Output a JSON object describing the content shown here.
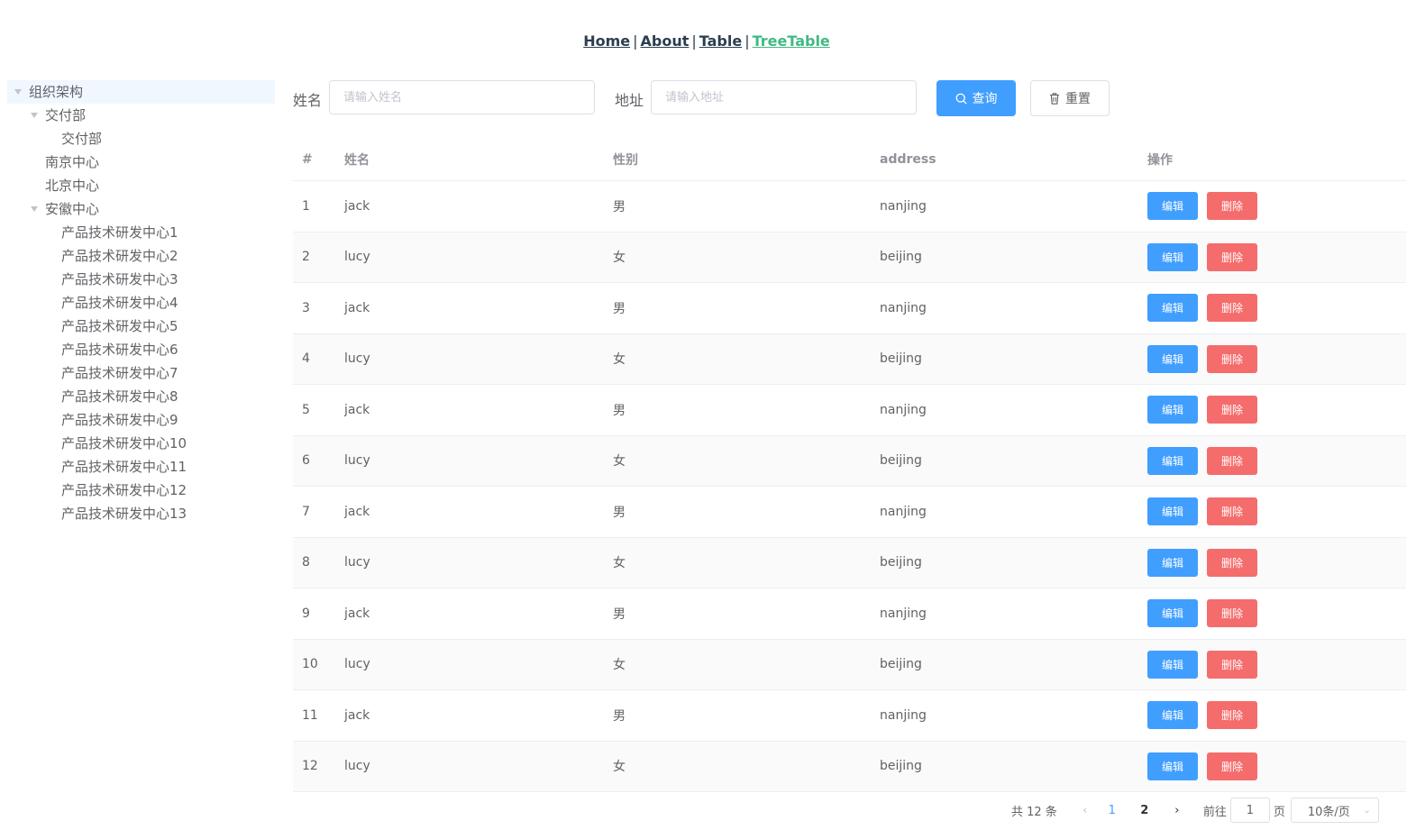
{
  "nav": {
    "links": [
      "Home",
      "About",
      "Table",
      "TreeTable"
    ],
    "separator": "|",
    "active": "TreeTable"
  },
  "tree": {
    "root": "组织架构",
    "nodes": [
      {
        "label": "交付部",
        "expanded": true,
        "level": 1
      },
      {
        "label": "交付部",
        "level": 2
      },
      {
        "label": "南京中心",
        "level": 1
      },
      {
        "label": "北京中心",
        "level": 1
      },
      {
        "label": "安徽中心",
        "expanded": true,
        "level": 1
      },
      {
        "label": "产品技术研发中心1",
        "level": 2
      },
      {
        "label": "产品技术研发中心2",
        "level": 2
      },
      {
        "label": "产品技术研发中心3",
        "level": 2
      },
      {
        "label": "产品技术研发中心4",
        "level": 2
      },
      {
        "label": "产品技术研发中心5",
        "level": 2
      },
      {
        "label": "产品技术研发中心6",
        "level": 2
      },
      {
        "label": "产品技术研发中心7",
        "level": 2
      },
      {
        "label": "产品技术研发中心8",
        "level": 2
      },
      {
        "label": "产品技术研发中心9",
        "level": 2
      },
      {
        "label": "产品技术研发中心10",
        "level": 2
      },
      {
        "label": "产品技术研发中心11",
        "level": 2
      },
      {
        "label": "产品技术研发中心12",
        "level": 2
      },
      {
        "label": "产品技术研发中心13",
        "level": 2
      }
    ]
  },
  "search": {
    "name_label": "姓名",
    "name_placeholder": "请输入姓名",
    "name_value": "",
    "address_label": "地址",
    "address_placeholder": "请输入地址",
    "address_value": "",
    "query_label": "查询",
    "reset_label": "重置"
  },
  "table": {
    "headers": [
      "#",
      "姓名",
      "性别",
      "address",
      "操作"
    ],
    "edit_label": "编辑",
    "delete_label": "删除",
    "rows": [
      {
        "id": "1",
        "name": "jack",
        "gender": "男",
        "address": "nanjing"
      },
      {
        "id": "2",
        "name": "lucy",
        "gender": "女",
        "address": "beijing"
      },
      {
        "id": "3",
        "name": "jack",
        "gender": "男",
        "address": "nanjing"
      },
      {
        "id": "4",
        "name": "lucy",
        "gender": "女",
        "address": "beijing"
      },
      {
        "id": "5",
        "name": "jack",
        "gender": "男",
        "address": "nanjing"
      },
      {
        "id": "6",
        "name": "lucy",
        "gender": "女",
        "address": "beijing"
      },
      {
        "id": "7",
        "name": "jack",
        "gender": "男",
        "address": "nanjing"
      },
      {
        "id": "8",
        "name": "lucy",
        "gender": "女",
        "address": "beijing"
      },
      {
        "id": "9",
        "name": "jack",
        "gender": "男",
        "address": "nanjing"
      },
      {
        "id": "10",
        "name": "lucy",
        "gender": "女",
        "address": "beijing"
      },
      {
        "id": "11",
        "name": "jack",
        "gender": "男",
        "address": "nanjing"
      },
      {
        "id": "12",
        "name": "lucy",
        "gender": "女",
        "address": "beijing"
      }
    ]
  },
  "pagination": {
    "total_text": "共 12 条",
    "pages": [
      "1",
      "2"
    ],
    "current_page": "1",
    "goto_label": "前往",
    "goto_value": "1",
    "page_unit": "页",
    "page_size": "10条/页"
  },
  "colors": {
    "primary": "#409eff",
    "danger": "#f56c6c",
    "nav_active": "#42b983",
    "nav_text": "#2c3e50"
  }
}
